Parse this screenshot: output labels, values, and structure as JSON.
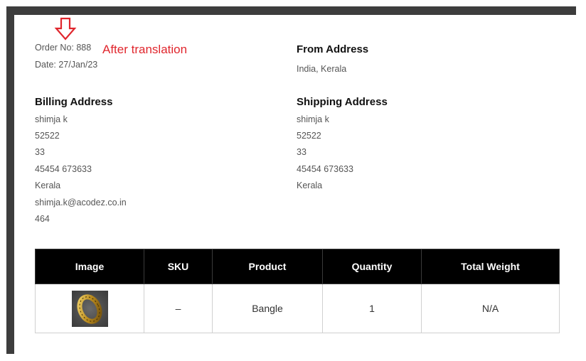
{
  "order": {
    "order_no": "Order No: 888",
    "date": "Date: 27/Jan/23"
  },
  "annotation": {
    "text": "After translation",
    "arrow_icon": "down-arrow-outline-icon",
    "color": "#e0262d"
  },
  "from_address": {
    "heading": "From Address",
    "lines": [
      "India, Kerala"
    ]
  },
  "billing_address": {
    "heading": "Billing Address",
    "lines": [
      "shimja k",
      "52522",
      "33",
      "45454 673633",
      "Kerala",
      "shimja.k@acodez.co.in",
      "464"
    ]
  },
  "shipping_address": {
    "heading": "Shipping Address",
    "lines": [
      "shimja k",
      "52522",
      "33",
      "45454 673633",
      "Kerala"
    ]
  },
  "table": {
    "headers": [
      "Image",
      "SKU",
      "Product",
      "Quantity",
      "Total Weight"
    ],
    "rows": [
      {
        "image_icon": "gold-ring-product-image",
        "sku": "–",
        "product": "Bangle",
        "quantity": "1",
        "total_weight": "N/A"
      }
    ]
  }
}
